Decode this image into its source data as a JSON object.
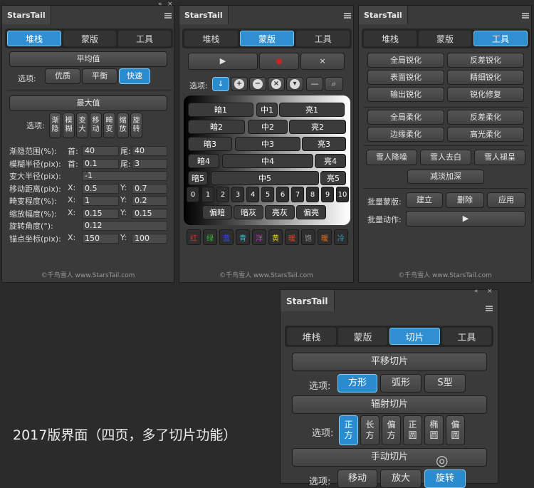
{
  "panel_title": "StarsTail",
  "footer": "©千鸟雪人 www.StarsTail.com",
  "tabs3": [
    "堆栈",
    "蒙版",
    "工具"
  ],
  "tabs4": [
    "堆栈",
    "蒙版",
    "切片",
    "工具"
  ],
  "p1": {
    "avg_title": "平均值",
    "opt_label": "选项:",
    "avg_opts": [
      "优质",
      "平衡",
      "快速"
    ],
    "max_title": "最大值",
    "max_opts": [
      "渐\n隐",
      "模\n糊",
      "变\n大",
      "移\n动",
      "畸\n变",
      "缩\n放",
      "旋\n转"
    ],
    "params": [
      {
        "label": "渐隐范围(%):",
        "a": "首:",
        "av": "40",
        "b": "尾:",
        "bv": "40"
      },
      {
        "label": "模糊半径(pix):",
        "a": "首:",
        "av": "0.1",
        "b": "尾:",
        "bv": "3"
      },
      {
        "label": "变大半径(pix):",
        "av": "-1"
      },
      {
        "label": "移动距离(pix):",
        "a": "X:",
        "av": "0.5",
        "b": "Y:",
        "bv": "0.7"
      },
      {
        "label": "畸变程度(%):",
        "a": "X:",
        "av": "1",
        "b": "Y:",
        "bv": "0.2"
      },
      {
        "label": "缩放幅度(%):",
        "a": "X:",
        "av": "0.15",
        "b": "Y:",
        "bv": "0.15"
      },
      {
        "label": "旋转角度(°):",
        "av": "0.12"
      },
      {
        "label": "锚点坐标(pix):",
        "a": "X:",
        "av": "150",
        "b": "Y:",
        "bv": "100"
      }
    ]
  },
  "p2": {
    "play": "▶",
    "record": "●",
    "close": "×",
    "opt_label": "选项:",
    "grid_rows": [
      [
        "暗1",
        "中1",
        "亮1"
      ],
      [
        "暗2",
        "中2",
        "亮2"
      ],
      [
        "暗3",
        "中3",
        "亮3"
      ],
      [
        "暗4",
        "中4",
        "亮4"
      ],
      [
        "暗5",
        "中5",
        "亮5"
      ]
    ],
    "numbers": [
      "0",
      "1",
      "2",
      "3",
      "4",
      "5",
      "6",
      "7",
      "8",
      "9",
      "10"
    ],
    "tone_btns": [
      "偏暗",
      "暗灰",
      "亮灰",
      "偏亮"
    ],
    "colors": [
      {
        "t": "红",
        "c": "#e03030"
      },
      {
        "t": "绿",
        "c": "#30c030"
      },
      {
        "t": "蓝",
        "c": "#3050e0"
      },
      {
        "t": "青",
        "c": "#30c0d0"
      },
      {
        "t": "洋",
        "c": "#d030d0"
      },
      {
        "t": "黄",
        "c": "#e0d030"
      },
      {
        "t": "暖",
        "c": "#e04020"
      },
      {
        "t": "饱",
        "c": "#999999"
      },
      {
        "t": "暖",
        "c": "#e07020"
      },
      {
        "t": "冷",
        "c": "#30a0d0"
      }
    ]
  },
  "p3": {
    "grid1": [
      "全局锐化",
      "反差锐化",
      "表面锐化",
      "精细锐化",
      "输出锐化",
      "锐化修复"
    ],
    "grid2": [
      "全局柔化",
      "反差柔化",
      "边缘柔化",
      "高光柔化"
    ],
    "snow": [
      "雪人降噪",
      "雪人去白",
      "雪人褪呈"
    ],
    "reduce": "减淡加深",
    "batch_mask_label": "批量蒙版:",
    "batch_mask": [
      "建立",
      "删除",
      "应用"
    ],
    "batch_action_label": "批量动作:",
    "batch_action": "▶"
  },
  "p4": {
    "move_title": "平移切片",
    "opt_label": "选项:",
    "move_opts": [
      "方形",
      "弧形",
      "S型"
    ],
    "radial_title": "辐射切片",
    "radial_opts": [
      "正\n方",
      "长\n方",
      "偏\n方",
      "正\n圆",
      "椭\n圆",
      "偏\n圆"
    ],
    "manual_title": "手动切片",
    "manual_opts": [
      "移动",
      "放大",
      "旋转"
    ]
  },
  "caption": "2017版界面（四页，多了切片功能）",
  "watermark": "◎"
}
